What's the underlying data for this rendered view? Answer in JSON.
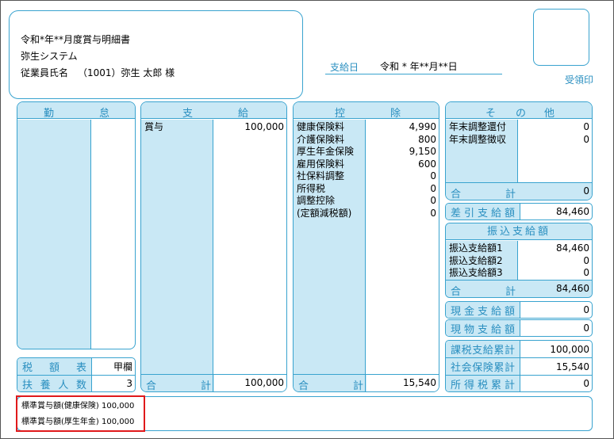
{
  "header": {
    "title": "令和*年**月度賞与明細書",
    "company": "弥生システム",
    "employee_label": "従業員氏名",
    "employee_value": "（1001）弥生 太郎 様",
    "payday_label": "支給日",
    "payday_value": "令和 * 年**月**日",
    "stamp_label": "受領印"
  },
  "attendance": {
    "heading": [
      "勤",
      "怠"
    ],
    "tax_table_label": [
      "税",
      "額",
      "表"
    ],
    "tax_table_value": "甲欄",
    "dependents_label": [
      "扶",
      "養",
      "人",
      "数"
    ],
    "dependents_value": "3"
  },
  "payment": {
    "heading": [
      "支",
      "給"
    ],
    "items": [
      {
        "label": "賞与",
        "value": "100,000"
      }
    ],
    "total_label": [
      "合",
      "計"
    ],
    "total_value": "100,000"
  },
  "deduction": {
    "heading": [
      "控",
      "除"
    ],
    "items": [
      {
        "label": "健康保険料",
        "value": "4,990"
      },
      {
        "label": "介護保険料",
        "value": "800"
      },
      {
        "label": "厚生年金保険",
        "value": "9,150"
      },
      {
        "label": "雇用保険料",
        "value": "600"
      },
      {
        "label": "社保料調整",
        "value": "0"
      },
      {
        "label": "所得税",
        "value": "0"
      },
      {
        "label": "調整控除",
        "value": "0"
      },
      {
        "label": "(定額減税額)",
        "value": "0"
      }
    ],
    "total_label": [
      "合",
      "計"
    ],
    "total_value": "15,540"
  },
  "other": {
    "heading": [
      "そ",
      "の",
      "他"
    ],
    "items": [
      {
        "label": "年末調整還付",
        "value": "0"
      },
      {
        "label": "年末調整徴収",
        "value": "0"
      }
    ],
    "total_label": [
      "合",
      "計"
    ],
    "total_value": "0",
    "net_label": [
      "差",
      "引",
      "支",
      "給",
      "額"
    ],
    "net_value": "84,460"
  },
  "transfer": {
    "heading": "振込支給額",
    "items": [
      {
        "label": "振込支給額1",
        "value": "84,460"
      },
      {
        "label": "振込支給額2",
        "value": "0"
      },
      {
        "label": "振込支給額3",
        "value": "0"
      }
    ],
    "total_label": [
      "合",
      "計"
    ],
    "total_value": "84,460"
  },
  "cash": {
    "label": [
      "現",
      "金",
      "支",
      "給",
      "額"
    ],
    "value": "0"
  },
  "inkind": {
    "label": [
      "現",
      "物",
      "支",
      "給",
      "額"
    ],
    "value": "0"
  },
  "cumulative": [
    {
      "label": [
        "課",
        "税",
        "支",
        "給",
        "累",
        "計"
      ],
      "value": "100,000"
    },
    {
      "label": [
        "社",
        "会",
        "保",
        "険",
        "累",
        "計"
      ],
      "value": "15,540"
    },
    {
      "label": [
        "所",
        "得",
        "税",
        "累",
        "計"
      ],
      "value": "0"
    }
  ],
  "notes": [
    "標準賞与額(健康保険) 100,000",
    "標準賞与額(厚生年金) 100,000"
  ],
  "highlight_color": "#e0191b",
  "accent_color": "#39a3cf",
  "header_fill": "#c9e8f5"
}
